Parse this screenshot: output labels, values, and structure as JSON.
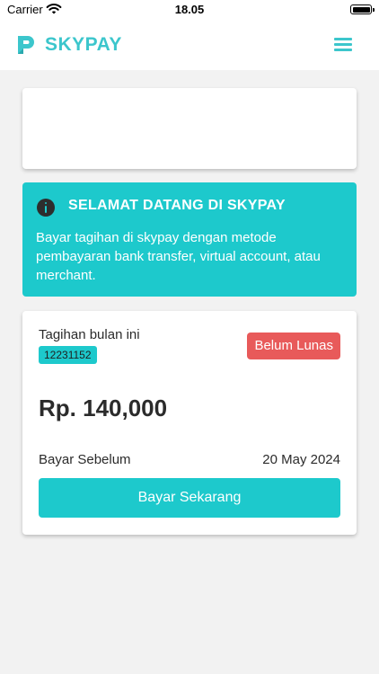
{
  "status_bar": {
    "carrier": "Carrier",
    "time": "18.05"
  },
  "header": {
    "logo_text": "SKYPAY",
    "brand_color": "#3cc6cc",
    "menu_icon": "hamburger-menu-icon"
  },
  "welcome": {
    "icon": "info-icon",
    "title": "SELAMAT DATANG DI SKYPAY",
    "text": "Bayar tagihan di skypay dengan metode pembayaran bank transfer, virtual account, atau merchant.",
    "background_color": "#1dc9cc"
  },
  "bill": {
    "label": "Tagihan bulan ini",
    "id": "12231152",
    "status": "Belum Lunas",
    "status_color": "#e85a5a",
    "amount": "Rp. 140,000",
    "due_label": "Bayar Sebelum",
    "due_date": "20 May 2024",
    "pay_button": "Bayar Sekarang"
  }
}
